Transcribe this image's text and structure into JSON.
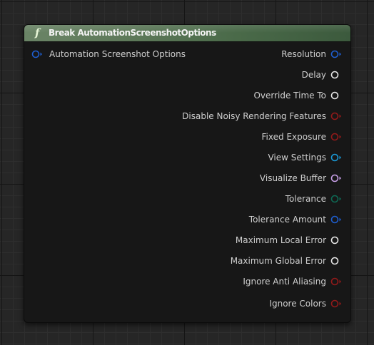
{
  "node": {
    "icon": "function-icon",
    "icon_glyph": "f",
    "title": "Break AutomationScreenshotOptions",
    "header_color": "#5f7a5b",
    "input_pin": {
      "label": "Automation Screenshot Options",
      "color": "#1e5fd2",
      "type": "struct"
    },
    "output_pins": [
      {
        "key": "resolution",
        "label": "Resolution",
        "color": "#1e5fd2",
        "type": "struct"
      },
      {
        "key": "delay",
        "label": "Delay",
        "color": "#e8e8e8",
        "type": "float"
      },
      {
        "key": "override-time-to",
        "label": "Override Time To",
        "color": "#e8e8e8",
        "type": "float"
      },
      {
        "key": "disable-noisy-rendering-features",
        "label": "Disable Noisy Rendering Features",
        "color": "#931a1a",
        "type": "bool"
      },
      {
        "key": "fixed-exposure",
        "label": "Fixed Exposure",
        "color": "#931a1a",
        "type": "bool"
      },
      {
        "key": "view-settings",
        "label": "View Settings",
        "color": "#1a9ad8",
        "type": "object"
      },
      {
        "key": "visualize-buffer",
        "label": "Visualize Buffer",
        "color": "#c8a0e8",
        "type": "name"
      },
      {
        "key": "tolerance",
        "label": "Tolerance",
        "color": "#0e6a55",
        "type": "enum"
      },
      {
        "key": "tolerance-amount",
        "label": "Tolerance Amount",
        "color": "#1e5fd2",
        "type": "struct"
      },
      {
        "key": "maximum-local-error",
        "label": "Maximum Local Error",
        "color": "#e8e8e8",
        "type": "float"
      },
      {
        "key": "maximum-global-error",
        "label": "Maximum Global Error",
        "color": "#e8e8e8",
        "type": "float"
      },
      {
        "key": "ignore-anti-aliasing",
        "label": "Ignore Anti Aliasing",
        "color": "#931a1a",
        "type": "bool"
      },
      {
        "key": "ignore-colors",
        "label": "Ignore Colors",
        "color": "#931a1a",
        "type": "bool"
      }
    ]
  }
}
